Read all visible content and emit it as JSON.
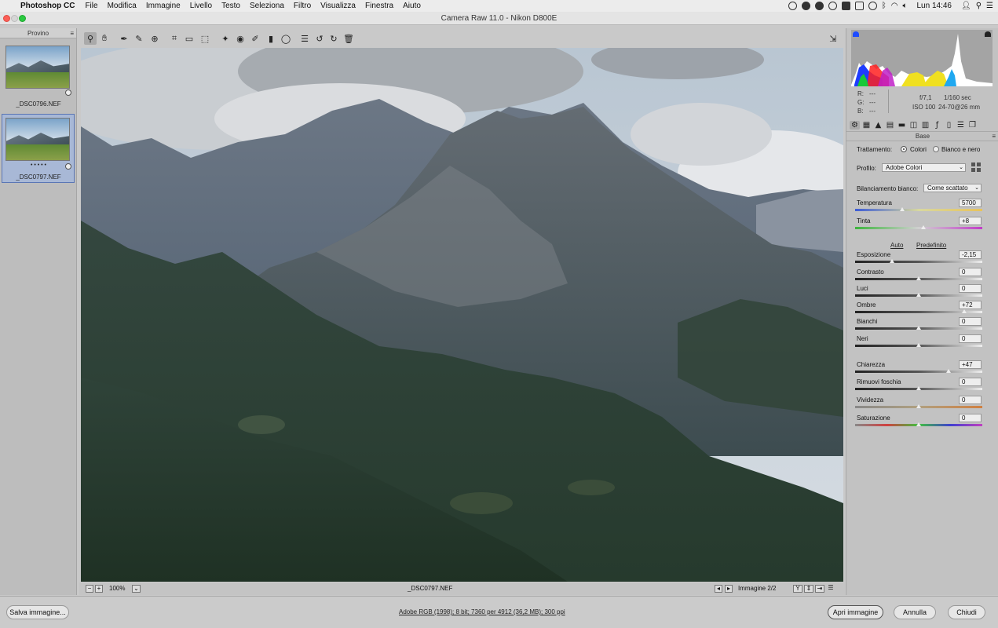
{
  "menubar": {
    "app_name": "Photoshop CC",
    "items": [
      "File",
      "Modifica",
      "Immagine",
      "Livello",
      "Testo",
      "Seleziona",
      "Filtro",
      "Visualizza",
      "Finestra",
      "Aiuto"
    ],
    "clock": "Lun 14:46"
  },
  "window": {
    "title": "Camera Raw 11.0  -  Nikon D800E"
  },
  "filmstrip": {
    "header": "Provino",
    "items": [
      {
        "name": "_DSC0796.NEF",
        "rating": "",
        "selected": false
      },
      {
        "name": "_DSC0797.NEF",
        "rating": "• • • • •",
        "selected": true
      }
    ]
  },
  "toolbar": {
    "tools": [
      "zoom-icon",
      "hand-icon",
      "white-balance-icon",
      "color-sampler-icon",
      "targeted-adjustment-icon",
      "crop-icon",
      "straighten-icon",
      "transform-icon",
      "spot-removal-icon",
      "red-eye-icon",
      "adjustment-brush-icon",
      "graduated-filter-icon",
      "radial-filter-icon",
      "preferences-icon",
      "rotate-left-icon",
      "rotate-right-icon",
      "trash-icon"
    ]
  },
  "image_footer": {
    "zoom": "100%",
    "filename": "_DSC0797.NEF",
    "nav_label": "Immagine 2/2"
  },
  "histogram": {
    "readout": {
      "r": "R:",
      "g": "G:",
      "b": "B:",
      "dash": "---",
      "aperture": "f/7,1",
      "shutter": "1/160 sec",
      "iso": "ISO 100",
      "lens": "24-70@26 mm"
    }
  },
  "panel": {
    "section_title": "Base",
    "treatment_label": "Trattamento:",
    "treatment_color": "Colori",
    "treatment_bw": "Bianco e nero",
    "profile_label": "Profilo:",
    "profile_value": "Adobe Colori",
    "wb_label": "Bilanciamento bianco:",
    "wb_value": "Come scattato",
    "auto": "Auto",
    "default": "Predefinito",
    "sliders": [
      {
        "label": "Temperatura",
        "value": "5700",
        "pos": 0.37
      },
      {
        "label": "Tinta",
        "value": "+8",
        "pos": 0.54
      },
      {
        "label": "Esposizione",
        "value": "-2,15",
        "pos": 0.29
      },
      {
        "label": "Contrasto",
        "value": "0",
        "pos": 0.5
      },
      {
        "label": "Luci",
        "value": "0",
        "pos": 0.5
      },
      {
        "label": "Ombre",
        "value": "+72",
        "pos": 0.86
      },
      {
        "label": "Bianchi",
        "value": "0",
        "pos": 0.5
      },
      {
        "label": "Neri",
        "value": "0",
        "pos": 0.5
      },
      {
        "label": "Chiarezza",
        "value": "+47",
        "pos": 0.735
      },
      {
        "label": "Rimuovi foschia",
        "value": "0",
        "pos": 0.5
      },
      {
        "label": "Vividezza",
        "value": "0",
        "pos": 0.5
      },
      {
        "label": "Saturazione",
        "value": "0",
        "pos": 0.5
      }
    ]
  },
  "bottom": {
    "save": "Salva immagine...",
    "workflow": "Adobe RGB (1998); 8 bit; 7360 per 4912 (36,2 MB); 300 ppi",
    "open": "Apri immagine",
    "cancel": "Annulla",
    "close": "Chiudi"
  }
}
